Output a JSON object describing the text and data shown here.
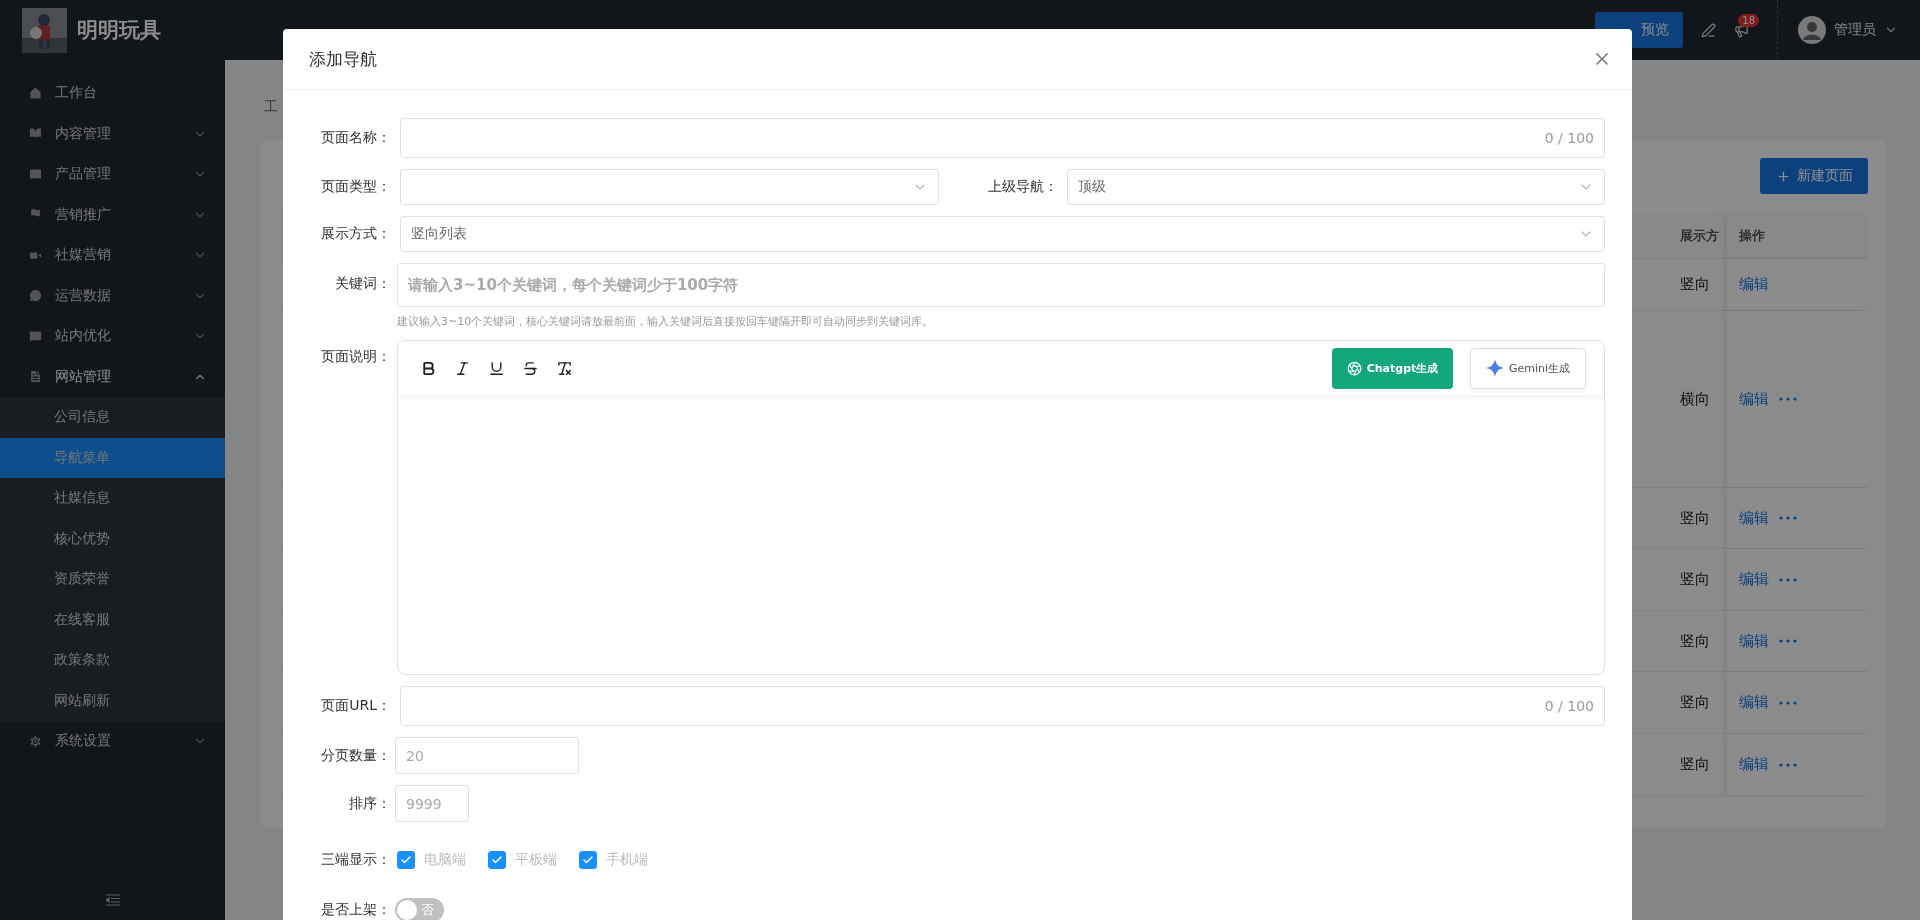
{
  "header": {
    "brand": "明明玩具",
    "preview_button": "预览",
    "notification_count": "18",
    "user": "管理员"
  },
  "sidebar": {
    "items": [
      {
        "label": "工作台"
      },
      {
        "label": "内容管理",
        "expanded": false
      },
      {
        "label": "产品管理",
        "expanded": false
      },
      {
        "label": "营销推广",
        "expanded": false
      },
      {
        "label": "社媒营销",
        "expanded": false
      },
      {
        "label": "运营数据",
        "expanded": false
      },
      {
        "label": "站内优化",
        "expanded": false
      },
      {
        "label": "网站管理",
        "expanded": true,
        "children": [
          {
            "label": "公司信息",
            "selected": false
          },
          {
            "label": "导航菜单",
            "selected": true
          },
          {
            "label": "社媒信息",
            "selected": false
          },
          {
            "label": "核心优势",
            "selected": false
          },
          {
            "label": "资质荣誉",
            "selected": false
          },
          {
            "label": "在线客服",
            "selected": false
          },
          {
            "label": "政策条款",
            "selected": false
          },
          {
            "label": "网站刷新",
            "selected": false
          }
        ]
      },
      {
        "label": "系统设置",
        "expanded": false
      }
    ]
  },
  "breadcrumb": "工",
  "page": {
    "new_button": "新建页面",
    "table": {
      "columns": [
        "展示方",
        "操作"
      ],
      "rows": [
        {
          "display": "竖向",
          "action": "编辑",
          "more": false
        },
        {
          "display": "横向",
          "action": "编辑",
          "more": true
        },
        {
          "display": "竖向",
          "action": "编辑",
          "more": true
        },
        {
          "display": "竖向",
          "action": "编辑",
          "more": true
        },
        {
          "display": "竖向",
          "action": "编辑",
          "more": true
        },
        {
          "display": "竖向",
          "action": "编辑",
          "more": true
        },
        {
          "display": "竖向",
          "action": "编辑",
          "more": true
        }
      ]
    }
  },
  "dialog": {
    "title": "添加导航",
    "fields": [
      {
        "kind": "text",
        "label": "页面名称：",
        "counter": "0 / 100"
      },
      {
        "kind": "select_pair",
        "items": [
          {
            "label": "页面类型："
          },
          {
            "label": "上级导航：",
            "value": "顶级"
          }
        ]
      },
      {
        "kind": "select",
        "label": "展示方式：",
        "value": "竖向列表"
      },
      {
        "kind": "keywords",
        "label": "关键词：",
        "placeholder": "请输入3~10个关键词，每个关键词少于100字符",
        "help": "建议输入3~10个关键词，核心关键词请放最前面，输入关键词后直接按回车键隔开即可自动同步到关键词库。"
      },
      {
        "kind": "editor",
        "label": "页面说明：",
        "buttons": [
          {
            "kind": "chatgpt",
            "label": "Chatgpt生成"
          },
          {
            "kind": "gemini",
            "label": "Gemini生成"
          }
        ]
      },
      {
        "kind": "text",
        "label": "页面URL：",
        "counter": "0 / 100"
      },
      {
        "kind": "number",
        "label": "分页数量：",
        "placeholder": "20"
      },
      {
        "kind": "sort",
        "label": "排序：",
        "placeholder": "9999"
      },
      {
        "kind": "checkboxes",
        "label": "三端显示：",
        "options": [
          {
            "label": "电脑端",
            "checked": true
          },
          {
            "label": "平板端",
            "checked": true
          },
          {
            "label": "手机端",
            "checked": true
          }
        ]
      },
      {
        "kind": "switch",
        "label": "是否上架：",
        "on": false,
        "text": "否"
      }
    ]
  }
}
